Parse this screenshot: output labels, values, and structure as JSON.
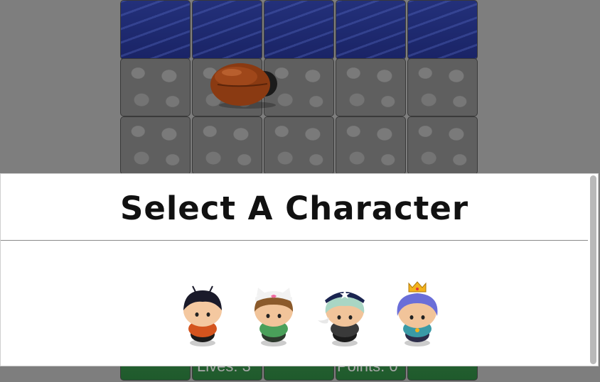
{
  "dialog": {
    "title": "Select A Character"
  },
  "hud": {
    "lives_text": "Lives: 3",
    "points_text": "Points: 0"
  },
  "characters": [
    {
      "id": "boy",
      "icon": "character-boy-icon"
    },
    {
      "id": "cat-girl",
      "icon": "character-cat-girl-icon"
    },
    {
      "id": "horn-girl",
      "icon": "character-horn-girl-icon"
    },
    {
      "id": "princess-girl",
      "icon": "character-princess-girl-icon"
    }
  ],
  "colors": {
    "water": "#23307a",
    "stone": "#5f5f5f",
    "grass": "#2f6b3a",
    "bug": "#8a3a12"
  }
}
